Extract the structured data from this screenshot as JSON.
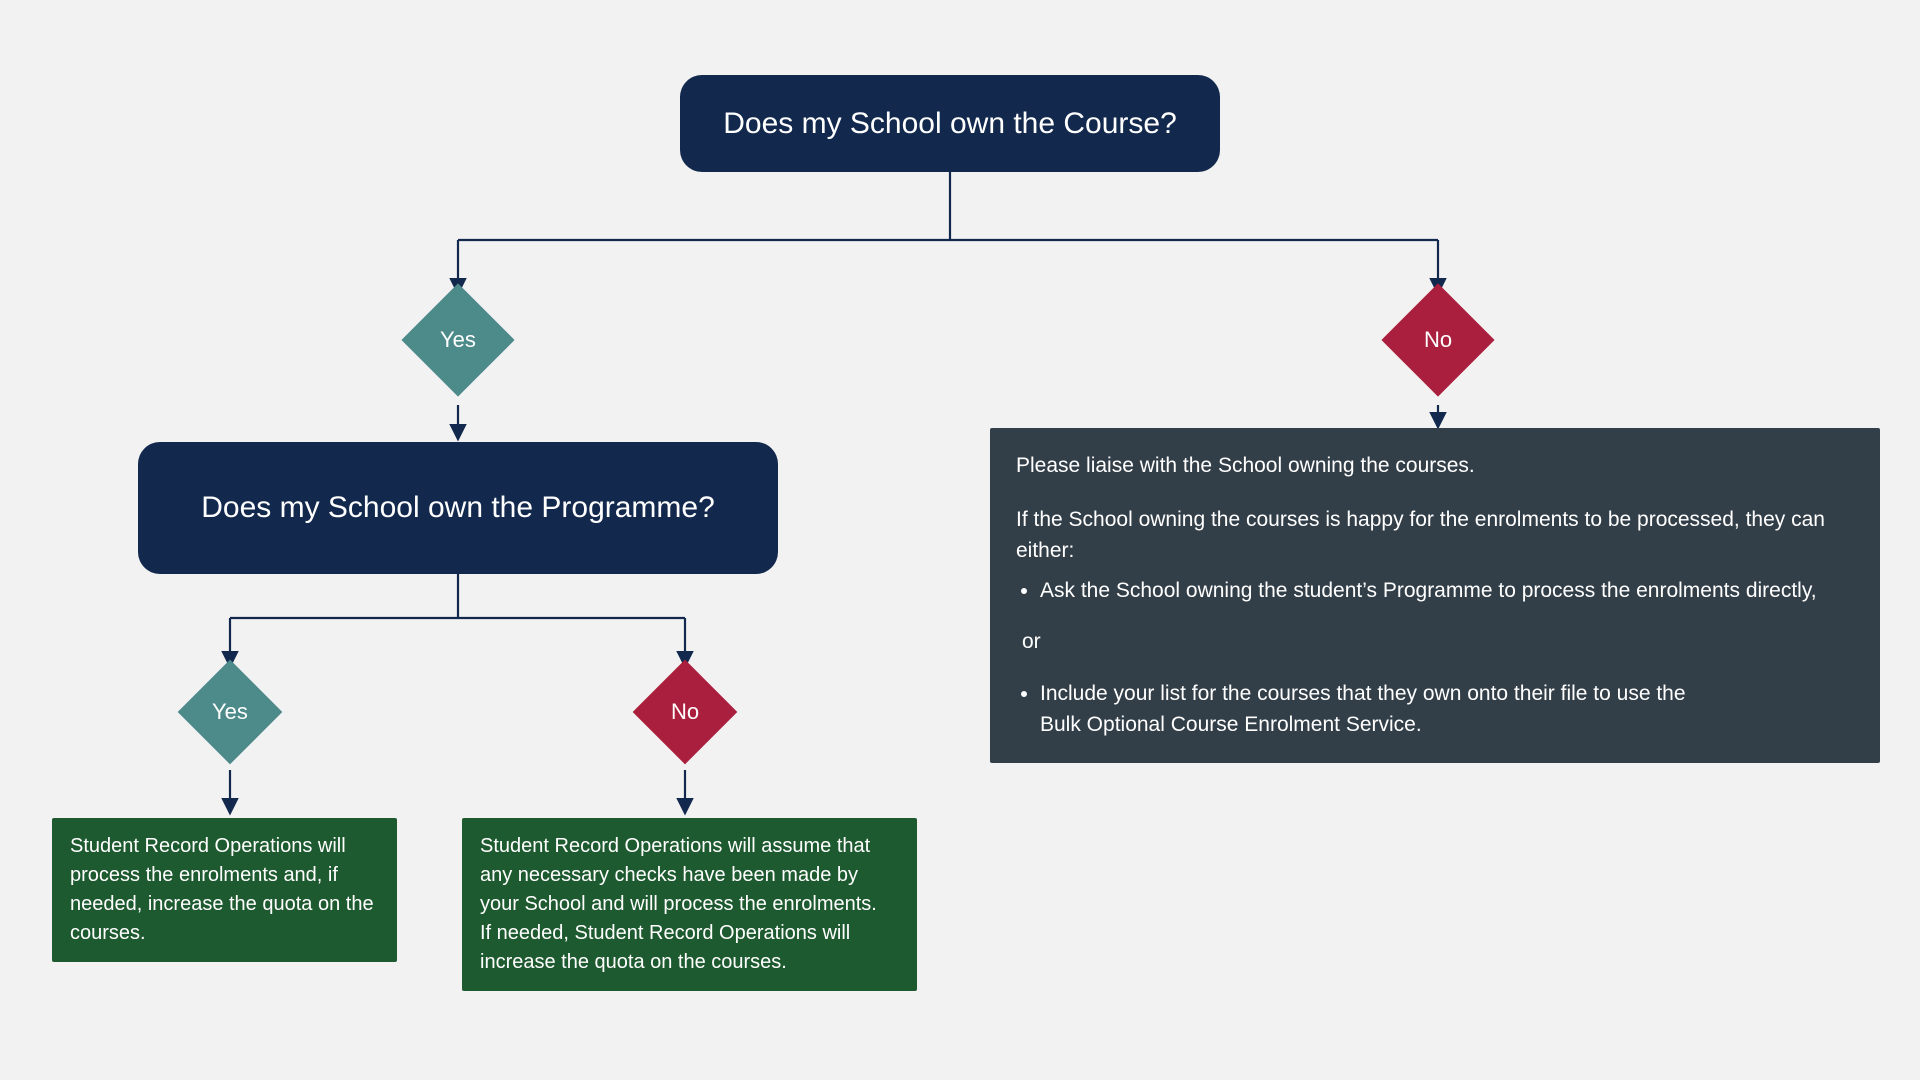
{
  "colors": {
    "dark_navy": "#12294d",
    "teal": "#4d8a8a",
    "crimson": "#aa1f3d",
    "forest_green": "#1e5a2f",
    "slate": "#333f48",
    "background": "#f2f2f2",
    "arrow": "#12294d"
  },
  "q1": {
    "text": "Does my School own the Course?"
  },
  "q2": {
    "text": "Does my School own the Programme?"
  },
  "dec": {
    "yes": "Yes",
    "no": "No"
  },
  "out_yes_yes": "Student Record Operations will process the enrolments and, if needed, increase the quota on the courses.",
  "out_yes_no": "Student Record Operations will assume that any necessary checks have been made by your School and will process the enrolments.\nIf needed, Student Record Operations will increase the quota on the courses.",
  "out_no": {
    "intro": "Please liaise with the School owning the courses.",
    "line2": "If the School owning the courses is happy for the enrolments to be processed, they can either:",
    "bullet1": "Ask the School owning the student’s Programme to process the enrolments directly,",
    "or": "or",
    "bullet2": "Include your list for the courses that they own onto their file to use the",
    "bullet2b": "Bulk Optional Course Enrolment Service."
  }
}
